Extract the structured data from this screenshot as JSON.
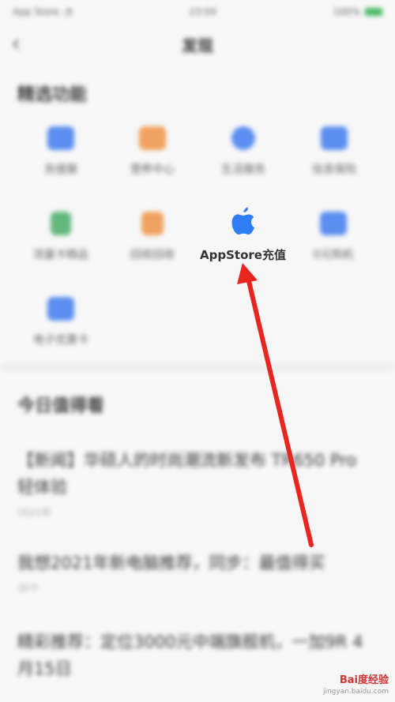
{
  "status_bar": {
    "carrier": "App Store",
    "time": "23:04",
    "battery": "100%"
  },
  "nav": {
    "back_icon": "chevron-left-icon",
    "title": "发现"
  },
  "featured": {
    "section_title": "精选功能",
    "items": [
      {
        "label": "充值服",
        "icon": "card-icon",
        "color": "#5b8ef0"
      },
      {
        "label": "营养中心",
        "icon": "bag-icon",
        "color": "#f0a260"
      },
      {
        "label": "生活服务",
        "icon": "circle-icon",
        "color": "#5b8ef0"
      },
      {
        "label": "信息保险",
        "icon": "calendar-icon",
        "color": "#5b8ef0"
      },
      {
        "label": "流量卡精品",
        "icon": "sim-icon",
        "color": "#63b87d"
      },
      {
        "label": "回收回收",
        "icon": "box-icon",
        "color": "#f0a260"
      },
      {
        "label": "AppStore充值",
        "icon": "apple-icon",
        "color": "#2f7ef6"
      },
      {
        "label": "0元购机",
        "icon": "phone-icon",
        "color": "#5b8ef0"
      },
      {
        "label": "电子优惠卡",
        "icon": "ticket-icon",
        "color": "#5b8ef0"
      }
    ]
  },
  "today": {
    "section_title": "今日值得看",
    "news": [
      {
        "title": "【新闻】华硕人的时尚潮流新发布 TR650 Pro 轻体验",
        "meta": "2021年",
        "lines": 2
      },
      {
        "title": "我想2021年新电脑推荐，同步：最值得买",
        "meta": "30个",
        "lines": 1
      },
      {
        "title": "精彩推荐：定位3000元中端旗舰机，一加9R 4月15日",
        "meta": "",
        "lines": 2
      }
    ]
  },
  "watermark": {
    "brand": "Bai度经验",
    "url": "jingyan.baidu.com"
  },
  "annotation": {
    "color": "#e8251f"
  }
}
